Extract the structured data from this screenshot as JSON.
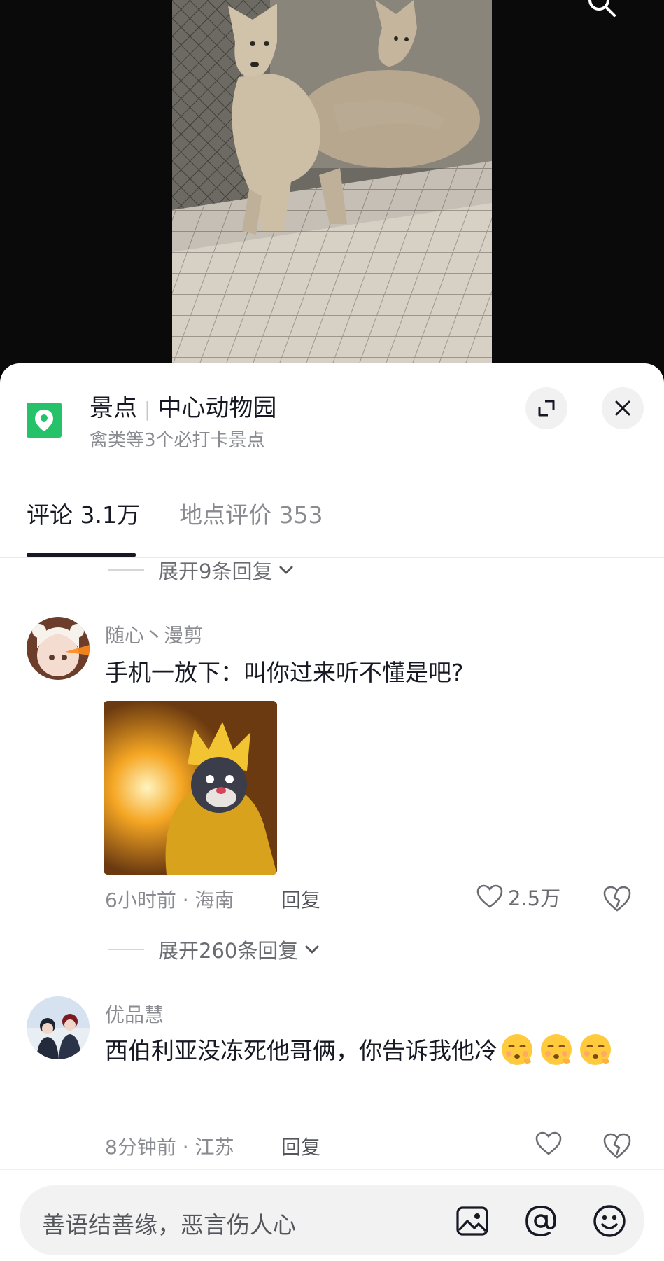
{
  "location": {
    "category": "景点",
    "name": "中心动物园",
    "subtitle": "禽类等3个必打卡景点"
  },
  "tabs": {
    "comments": "评论 3.1万",
    "reviews": "地点评价 353"
  },
  "expand_first": "展开9条回复",
  "comments": [
    {
      "user": "随心丶漫剪",
      "text": "手机一放下：叫你过来听不懂是吧?",
      "meta": "6小时前 · 海南",
      "reply": "回复",
      "likes": "2.5万",
      "expand": "展开260条回复"
    },
    {
      "user": "优品慧",
      "text": "西伯利亚没冻死他哥俩，你告诉我他冷",
      "meta": "8分钟前 · 江苏",
      "reply": "回复",
      "likes": ""
    }
  ],
  "input": {
    "placeholder": "善语结善缘，恶言伤人心"
  },
  "icons": {
    "location": "location-pin-icon",
    "expand": "expand-icon",
    "close": "close-icon",
    "like": "heart-icon",
    "dislike": "broken-heart-icon",
    "image": "image-icon",
    "mention": "at-icon",
    "emoji": "emoji-icon"
  },
  "colors": {
    "accent_green": "#25c26a",
    "text_primary": "#161823",
    "text_secondary": "#8a8b91"
  }
}
